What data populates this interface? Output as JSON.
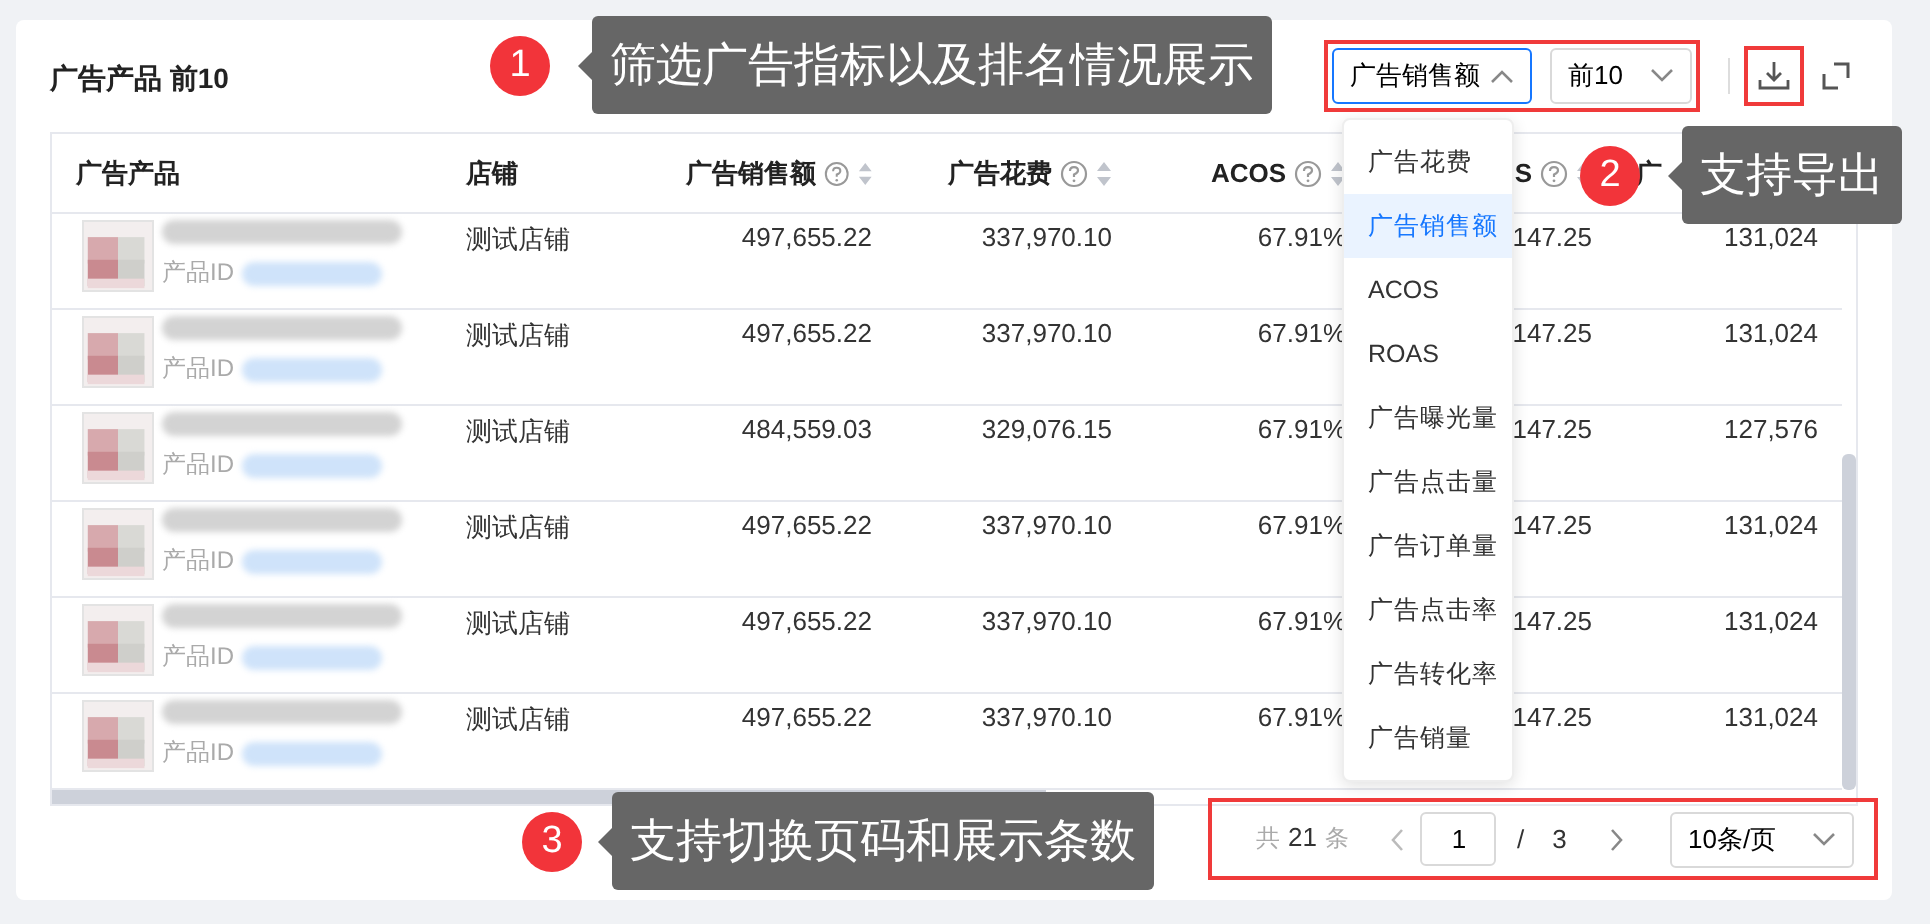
{
  "title": "广告产品 前10",
  "metric_select": {
    "value": "广告销售额",
    "expanded": true
  },
  "rank_select": {
    "value": "前10",
    "expanded": false
  },
  "metric_options": [
    {
      "label": "广告花费",
      "selected": false
    },
    {
      "label": "广告销售额",
      "selected": true
    },
    {
      "label": "ACOS",
      "selected": false
    },
    {
      "label": "ROAS",
      "selected": false
    },
    {
      "label": "广告曝光量",
      "selected": false
    },
    {
      "label": "广告点击量",
      "selected": false
    },
    {
      "label": "广告订单量",
      "selected": false
    },
    {
      "label": "广告点击率",
      "selected": false
    },
    {
      "label": "广告转化率",
      "selected": false
    },
    {
      "label": "广告销量",
      "selected": false
    }
  ],
  "table": {
    "columns": [
      {
        "label": "广告产品",
        "help": false,
        "sortable": false
      },
      {
        "label": "店铺",
        "help": false,
        "sortable": false
      },
      {
        "label": "广告销售额",
        "help": true,
        "sortable": true
      },
      {
        "label": "广告花费",
        "help": true,
        "sortable": true
      },
      {
        "label": "ACOS",
        "help": true,
        "sortable": true
      },
      {
        "label": "S",
        "help": true,
        "sortable": true
      },
      {
        "label": "广",
        "help": false,
        "sortable": false
      }
    ],
    "rows": [
      {
        "cells": [
          "产品ID",
          "测试店铺",
          "497,655.22",
          "337,970.10",
          "67.91%",
          "147.25",
          "131,024"
        ]
      },
      {
        "cells": [
          "产品ID",
          "测试店铺",
          "497,655.22",
          "337,970.10",
          "67.91%",
          "147.25",
          "131,024"
        ]
      },
      {
        "cells": [
          "产品ID",
          "测试店铺",
          "484,559.03",
          "329,076.15",
          "67.91%",
          "147.25",
          "127,576"
        ]
      },
      {
        "cells": [
          "产品ID",
          "测试店铺",
          "497,655.22",
          "337,970.10",
          "67.91%",
          "147.25",
          "131,024"
        ]
      },
      {
        "cells": [
          "产品ID",
          "测试店铺",
          "497,655.22",
          "337,970.10",
          "67.91%",
          "147.25",
          "131,024"
        ]
      },
      {
        "cells": [
          "产品ID",
          "测试店铺",
          "497,655.22",
          "337,970.10",
          "67.91%",
          "147.25",
          "131,024"
        ]
      }
    ]
  },
  "pagination": {
    "total_prefix": "共",
    "total": "21",
    "total_suffix": "条",
    "page": "1",
    "separator": "/",
    "pages": "3",
    "page_size": "10条/页"
  },
  "callouts": [
    {
      "number": "1",
      "text": "筛选广告指标以及排名情况展示"
    },
    {
      "number": "2",
      "text": "支持导出"
    },
    {
      "number": "3",
      "text": "支持切换页码和展示条数"
    }
  ]
}
